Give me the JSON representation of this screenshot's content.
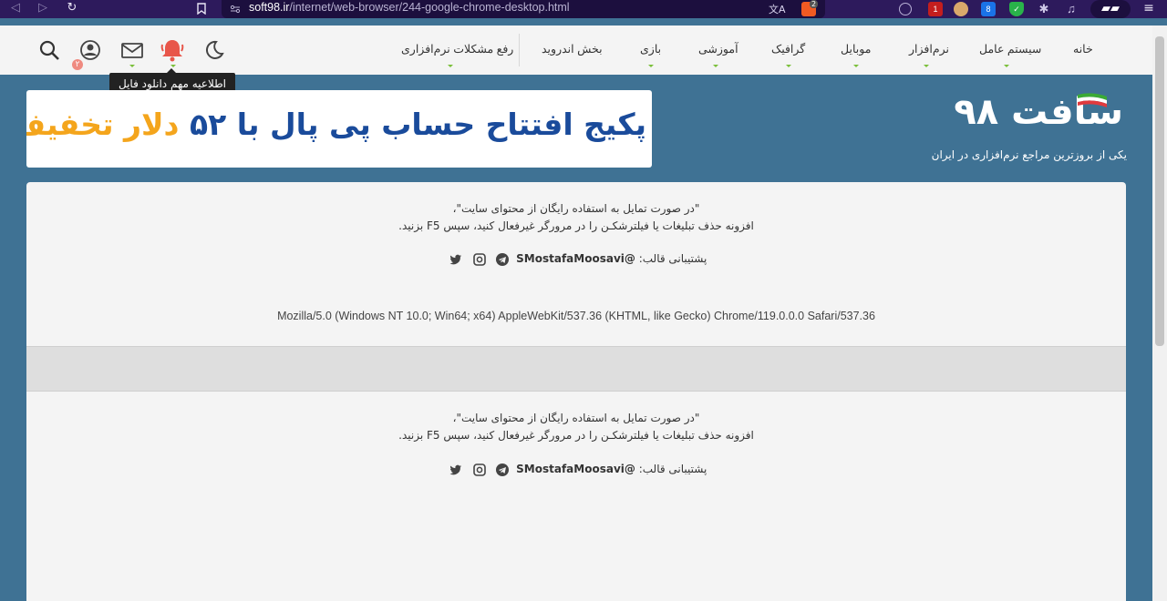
{
  "browser": {
    "url_host": "soft98.ir",
    "url_path": "/internet/web-browser/244-google-chrome-desktop.html",
    "translate_icon": "文A",
    "brave_badge": "2",
    "ext_badge_1": "1",
    "ext_badge_2": "8",
    "colors": {
      "bar": "#2d1a5c",
      "url_bg": "#1c0f3e"
    }
  },
  "site_nav": {
    "menu": [
      {
        "label": "خانه"
      },
      {
        "label": "سیستم عامل"
      },
      {
        "label": "نرم‌افزار"
      },
      {
        "label": "موبایل"
      },
      {
        "label": "گرافیک"
      },
      {
        "label": "آموزشی"
      },
      {
        "label": "بازی"
      },
      {
        "label": "بخش اندروید"
      },
      {
        "label": "رفع مشکلات نرم‌افزاری"
      }
    ],
    "notif_count": "۲",
    "tooltip": "اطلاعیه مهم دانلود فایل",
    "icons": [
      "moon-icon",
      "bell-icon",
      "mail-icon",
      "user-icon",
      "search-icon"
    ]
  },
  "banner": {
    "text_blue": "پکیج افتتاح حساب پی پال با",
    "text_number": "۵۲",
    "text_orange": "دلار تخفیف"
  },
  "logo": {
    "text": "سافت ۹۸",
    "tagline": "یکی از بروزترین مراجع نرم‌افزاری در ایران"
  },
  "panel1": {
    "notice_line1": "\"در صورت تمایل به استفاده رایگان از محتوای سایت\"،",
    "notice_line2": "افزونه حذف تبلیغات یا فیلترشکـن را در مرورگر غیرفعال کنید، سپس F5 بزنید.",
    "support_label": "پشتیبانی قالب:",
    "support_handle": "SMostafaMoosavi@",
    "user_agent": "Mozilla/5.0 (Windows NT 10.0; Win64; x64) AppleWebKit/537.36 (KHTML, like Gecko) Chrome/119.0.0.0 Safari/537.36"
  },
  "panel2": {
    "notice_line1": "\"در صورت تمایل به استفاده رایگان از محتوای سایت\"،",
    "notice_line2": "افزونه حذف تبلیغات یا فیلترشکـن را در مرورگر غیرفعال کنید، سپس F5 بزنید.",
    "support_label": "پشتیبانی قالب:",
    "support_handle": "SMostafaMoosavi@"
  },
  "colors": {
    "page_bg": "#3f7294",
    "panel_bg": "#f4f4f4",
    "accent_green": "#7bbf3a",
    "bell_red": "#e8564a",
    "banner_blue": "#1a4b9b",
    "banner_orange": "#f4a51c"
  }
}
